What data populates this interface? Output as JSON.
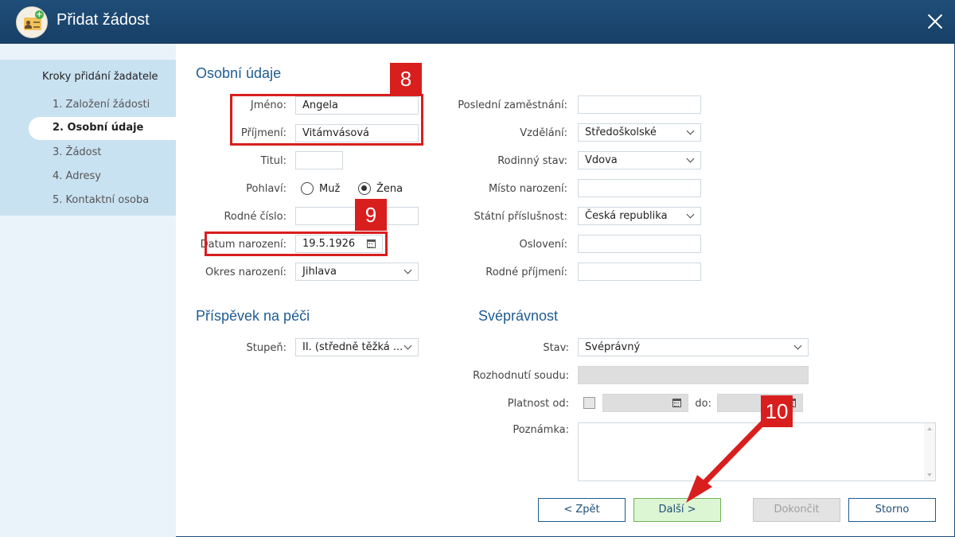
{
  "window": {
    "title": "Přidat žádost",
    "app_icon": "applicant-card-icon",
    "close_icon": "close-icon"
  },
  "sidebar": {
    "title": "Kroky přidání žadatele",
    "steps": [
      {
        "label": "1. Založení žádosti",
        "active": false
      },
      {
        "label": "2. Osobní údaje",
        "active": true
      },
      {
        "label": "3. Žádost",
        "active": false
      },
      {
        "label": "4. Adresy",
        "active": false
      },
      {
        "label": "5. Kontaktní osoba",
        "active": false
      }
    ]
  },
  "personal": {
    "heading": "Osobní údaje",
    "first_name": {
      "label": "Jméno:",
      "value": "Angela"
    },
    "last_name": {
      "label": "Příjmení:",
      "value": "Vitámvásová"
    },
    "title": {
      "label": "Titul:",
      "value": ""
    },
    "gender": {
      "label": "Pohlaví:",
      "options": [
        "Muž",
        "Žena"
      ],
      "selected": "Žena"
    },
    "birth_number": {
      "label": "Rodné číslo:",
      "value": ""
    },
    "birth_date": {
      "label": "Datum narození:",
      "value": "19.5.1926"
    },
    "birth_district": {
      "label": "Okres narození:",
      "value": "Jihlava"
    }
  },
  "personal_right": {
    "last_employment": {
      "label": "Poslední zaměstnání:",
      "value": ""
    },
    "education": {
      "label": "Vzdělání:",
      "value": "Středoškolské"
    },
    "marital_status": {
      "label": "Rodinný stav:",
      "value": "Vdova"
    },
    "birth_place": {
      "label": "Místo narození:",
      "value": ""
    },
    "citizenship": {
      "label": "Státní příslušnost:",
      "value": "Česká republika"
    },
    "salutation": {
      "label": "Oslovení:",
      "value": ""
    },
    "maiden_name": {
      "label": "Rodné příjmení:",
      "value": ""
    }
  },
  "care": {
    "heading": "Příspěvek na péči",
    "level": {
      "label": "Stupeň:",
      "value": "II. (středně těžká ..."
    }
  },
  "capacity": {
    "heading": "Svéprávnost",
    "status": {
      "label": "Stav:",
      "value": "Svéprávný"
    },
    "court_decision": {
      "label": "Rozhodnutí soudu:",
      "value": ""
    },
    "valid_from": {
      "label": "Platnost od:",
      "value": "",
      "checked": false
    },
    "valid_to": {
      "label": "do:",
      "value": ""
    },
    "note": {
      "label": "Poznámka:",
      "value": ""
    }
  },
  "buttons": {
    "back": "< Zpět",
    "next": "Další >",
    "finish": "Dokončit",
    "cancel": "Storno"
  },
  "annotations": {
    "badge_8": "8",
    "badge_9": "9",
    "badge_10": "10",
    "color": "#d91e1e"
  }
}
